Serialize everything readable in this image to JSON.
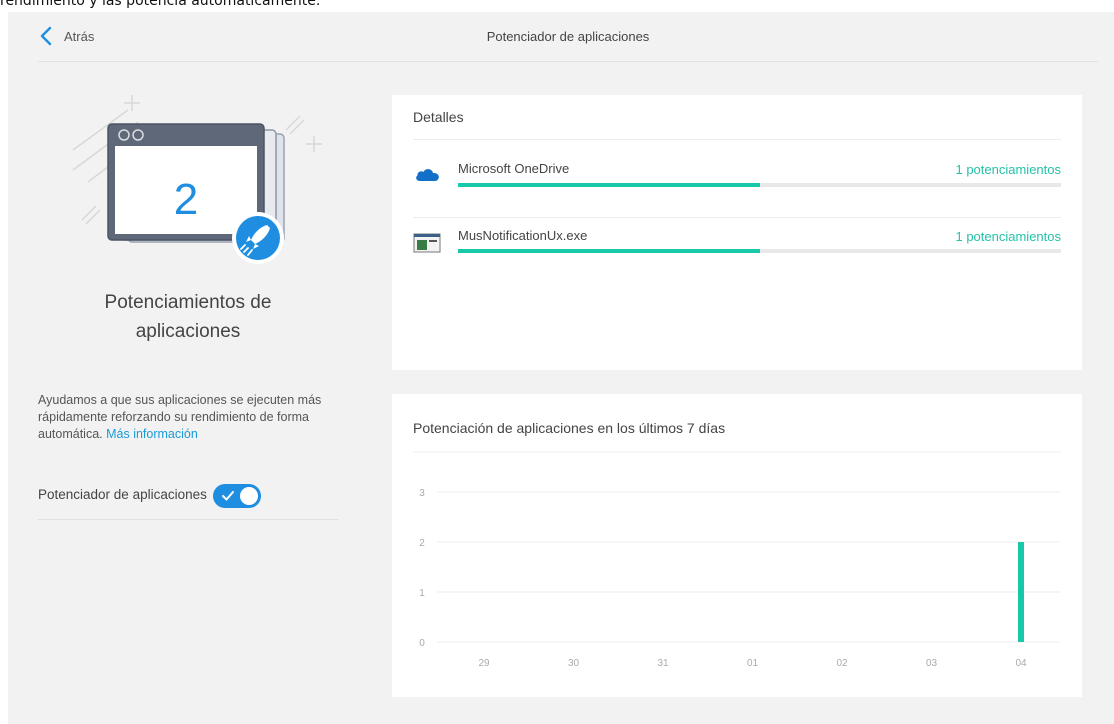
{
  "top_caption": "rendimiento y las potencia automáticamente.",
  "header": {
    "back_label": "Atrás",
    "title": "Potenciador de aplicaciones"
  },
  "left": {
    "boost_count": "2",
    "title_line1": "Potenciamientos de",
    "title_line2": "aplicaciones",
    "description": "Ayudamos a que sus aplicaciones se ejecuten más rápidamente reforzando su rendimiento de forma automática.",
    "more_info_link": "Más información",
    "toggle_label": "Potenciador de aplicaciones",
    "toggle_on": true,
    "icons": [
      "browser-window-icon",
      "rocket-icon",
      "sparkle-icon"
    ]
  },
  "details": {
    "title": "Detalles",
    "apps": [
      {
        "name": "Microsoft OneDrive",
        "count_label": "1 potenciamientos",
        "icon": "onedrive-cloud-icon",
        "progress": 0.5
      },
      {
        "name": "MusNotificationUx.exe",
        "count_label": "1 potenciamientos",
        "icon": "exe-window-icon",
        "progress": 0.5
      }
    ]
  },
  "colors": {
    "accent_teal": "#17c8a9",
    "accent_blue": "#1f8ee0",
    "link_blue": "#1a9bd7",
    "background": "#f2f2f2"
  },
  "chart_data": {
    "type": "bar",
    "title": "Potenciación de aplicaciones en los últimos 7 días",
    "categories": [
      "29",
      "30",
      "31",
      "01",
      "02",
      "03",
      "04"
    ],
    "values": [
      0,
      0,
      0,
      0,
      0,
      0,
      2
    ],
    "yticks": [
      "0",
      "1",
      "2",
      "3"
    ],
    "ylim": [
      0,
      3
    ],
    "grid": true,
    "bar_color": "#17c8a9"
  }
}
